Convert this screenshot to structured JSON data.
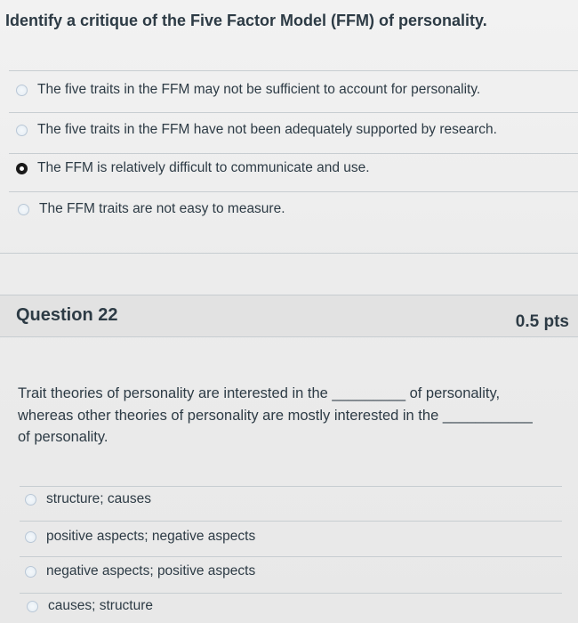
{
  "previous_question": {
    "prompt": "Identify a critique of the Five Factor Model (FFM) of personality.",
    "answers": [
      {
        "label": "The five traits in the FFM may not be sufficient to account for personality.",
        "selected": false
      },
      {
        "label": "The five traits in the FFM have not been adequately supported by research.",
        "selected": false
      },
      {
        "label": "The FFM is relatively difficult to communicate and use.",
        "selected": true
      },
      {
        "label": "The FFM traits are not easy to measure.",
        "selected": false
      }
    ]
  },
  "question_22": {
    "title": "Question 22",
    "points": "0.5 pts",
    "stem_line1": "Trait theories of personality are interested in the _________ of personality,",
    "stem_line2": "whereas other theories of personality are mostly interested in the ___________",
    "stem_line3": "of personality.",
    "answers": [
      {
        "label": "structure; causes",
        "selected": false
      },
      {
        "label": "positive aspects; negative aspects",
        "selected": false
      },
      {
        "label": "negative aspects; positive aspects",
        "selected": false
      },
      {
        "label": "causes; structure",
        "selected": false
      }
    ]
  },
  "colors": {
    "text": "#2d3b45",
    "header_bg": "#e2e2e2",
    "divider": "#c7cdd1",
    "selected_radio": "#1a1a1a"
  }
}
